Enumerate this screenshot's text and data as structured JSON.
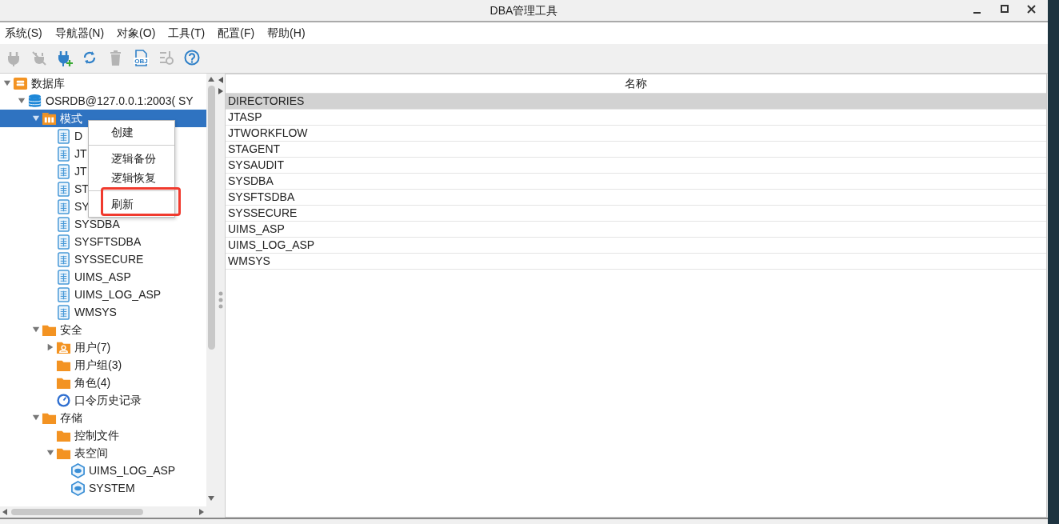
{
  "window": {
    "title": "DBA管理工具"
  },
  "menubar": [
    "系统(S)",
    "导航器(N)",
    "对象(O)",
    "工具(T)",
    "配置(F)",
    "帮助(H)"
  ],
  "toolbar": [
    {
      "kind": "plug",
      "disabled": true
    },
    {
      "kind": "unplug",
      "disabled": true
    },
    {
      "kind": "plug-add",
      "disabled": false
    },
    {
      "kind": "refresh",
      "disabled": false
    },
    {
      "kind": "trash",
      "disabled": true
    },
    {
      "kind": "obj",
      "disabled": false,
      "label": "OBJ"
    },
    {
      "kind": "filter",
      "disabled": true
    },
    {
      "kind": "help",
      "disabled": false
    }
  ],
  "tree": [
    {
      "label": "数据库",
      "kind": "db",
      "expanded": true,
      "selected": false,
      "children": [
        {
          "label": "OSRDB@127.0.0.1:2003( SY",
          "kind": "server",
          "expanded": true,
          "selected": false,
          "children": [
            {
              "label": "模式",
              "kind": "schema",
              "expanded": true,
              "selected": true,
              "children": [
                {
                  "label": "D",
                  "kind": "doc",
                  "selected": false
                },
                {
                  "label": "JT",
                  "kind": "doc",
                  "selected": false
                },
                {
                  "label": "JT",
                  "kind": "doc",
                  "selected": false
                },
                {
                  "label": "ST",
                  "kind": "doc",
                  "selected": false
                },
                {
                  "label": "SY",
                  "kind": "doc",
                  "selected": false
                },
                {
                  "label": "SYSDBA",
                  "kind": "doc",
                  "selected": false
                },
                {
                  "label": "SYSFTSDBA",
                  "kind": "doc",
                  "selected": false
                },
                {
                  "label": "SYSSECURE",
                  "kind": "doc",
                  "selected": false
                },
                {
                  "label": "UIMS_ASP",
                  "kind": "doc",
                  "selected": false
                },
                {
                  "label": "UIMS_LOG_ASP",
                  "kind": "doc",
                  "selected": false
                },
                {
                  "label": "WMSYS",
                  "kind": "doc",
                  "selected": false
                }
              ]
            },
            {
              "label": "安全",
              "kind": "folder",
              "expanded": true,
              "selected": false,
              "children": [
                {
                  "label": "用户(7)",
                  "kind": "user-folder",
                  "expanded": false,
                  "selected": false
                },
                {
                  "label": "用户组(3)",
                  "kind": "folder",
                  "selected": false
                },
                {
                  "label": "角色(4)",
                  "kind": "folder",
                  "selected": false
                },
                {
                  "label": "口令历史记录",
                  "kind": "history",
                  "selected": false
                }
              ]
            },
            {
              "label": "存储",
              "kind": "folder",
              "expanded": true,
              "selected": false,
              "children": [
                {
                  "label": "控制文件",
                  "kind": "folder",
                  "selected": false
                },
                {
                  "label": "表空间",
                  "kind": "folder",
                  "expanded": true,
                  "selected": false,
                  "children": [
                    {
                      "label": "UIMS_LOG_ASP",
                      "kind": "tablespace",
                      "selected": false
                    },
                    {
                      "label": "SYSTEM",
                      "kind": "tablespace",
                      "selected": false
                    }
                  ]
                }
              ]
            }
          ]
        }
      ]
    }
  ],
  "context_menu": [
    {
      "kind": "item",
      "label": "创建"
    },
    {
      "kind": "separator"
    },
    {
      "kind": "item",
      "label": "逻辑备份"
    },
    {
      "kind": "item",
      "label": "逻辑恢复"
    },
    {
      "kind": "separator"
    },
    {
      "kind": "item",
      "label": "刷新",
      "highlighted": true
    }
  ],
  "table": {
    "columns": [
      "名称"
    ],
    "rows": [
      {
        "name": "DIRECTORIES",
        "selected": true
      },
      {
        "name": "JTASP",
        "selected": false
      },
      {
        "name": "JTWORKFLOW",
        "selected": false
      },
      {
        "name": "STAGENT",
        "selected": false
      },
      {
        "name": "SYSAUDIT",
        "selected": false
      },
      {
        "name": "SYSDBA",
        "selected": false
      },
      {
        "name": "SYSFTSDBA",
        "selected": false
      },
      {
        "name": "SYSSECURE",
        "selected": false
      },
      {
        "name": "UIMS_ASP",
        "selected": false
      },
      {
        "name": "UIMS_LOG_ASP",
        "selected": false
      },
      {
        "name": "WMSYS",
        "selected": false
      }
    ]
  }
}
